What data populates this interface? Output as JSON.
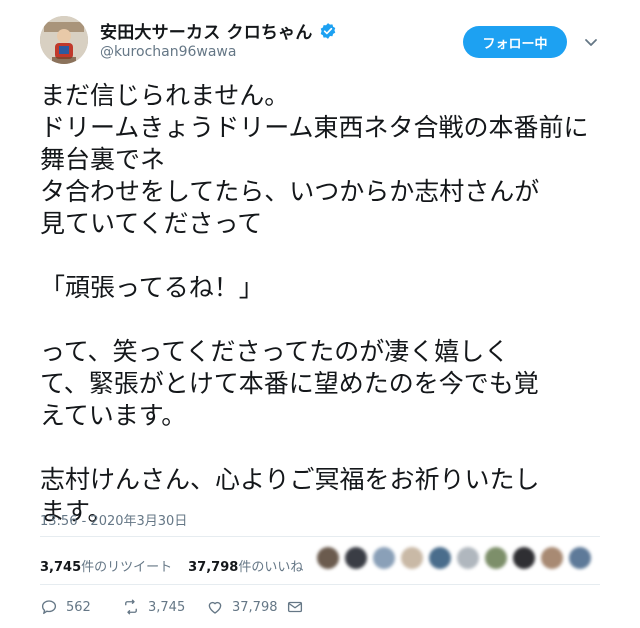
{
  "header": {
    "display_name": "安田大サーカス クロちゃん",
    "handle": "@kurochan96wawa",
    "follow_label": "フォロー中",
    "verified": true
  },
  "tweet": {
    "paragraphs": [
      [
        "まだ信じられません。",
        "ドリームきょうドリーム東西ネタ合戦の本番前に舞台裏でネ",
        "タ合わせをしてたら、いつからか志村さんが",
        "見ていてくださって"
      ],
      [
        "「頑張ってるね！」"
      ],
      [
        "って、笑ってくださってたのが凄く嬉しく",
        "て、緊張がとけて本番に望めたのを今でも覚",
        "えています。"
      ],
      [
        "志村けんさん、心よりご冥福をお祈りいたし",
        "ます。"
      ]
    ],
    "timestamp": "13:56 - 2020年3月30日"
  },
  "stats": {
    "retweets_count": "3,745",
    "retweets_label": "件のリツイート",
    "likes_count": "37,798",
    "likes_label": "件のいいね"
  },
  "actions": {
    "reply_count": "562",
    "retweet_count": "3,745",
    "like_count": "37,798"
  },
  "icons": {
    "verified": "verified-badge-icon",
    "chevron": "chevron-down-icon",
    "reply": "reply-icon",
    "retweet": "retweet-icon",
    "like": "heart-icon",
    "dm": "envelope-icon"
  },
  "colors": {
    "accent": "#1da1f2",
    "text": "#14171a",
    "muted": "#657786",
    "divider": "#e6ecf0"
  }
}
